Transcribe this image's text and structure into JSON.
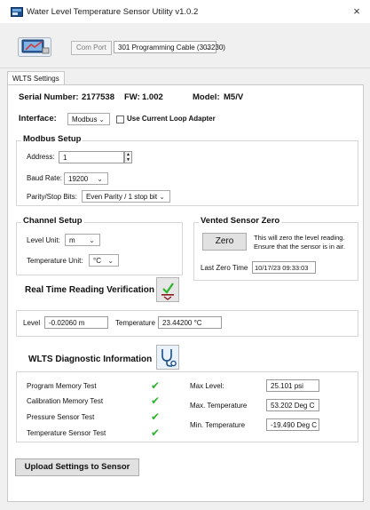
{
  "window": {
    "title": "Water Level Temperature Sensor Utility v1.0.2",
    "close_glyph": "×"
  },
  "toolbar": {
    "com_port_label": "Com Port",
    "com_port_value": "301 Programming Cable (303230)"
  },
  "tabs": [
    {
      "label": "WLTS Settings",
      "active": true
    }
  ],
  "device": {
    "serial_label": "Serial Number:",
    "serial": "2177538",
    "fw_label": "FW:",
    "fw": "1.002",
    "model_label": "Model:",
    "model": "M5/V"
  },
  "interface": {
    "label": "Interface:",
    "value": "Modbus",
    "use_loop_label": "Use Current Loop Adapter",
    "use_loop_checked": false
  },
  "modbus": {
    "title": "Modbus Setup",
    "address_label": "Address:",
    "address": "1",
    "baud_label": "Baud Rate:",
    "baud": "19200",
    "parity_label": "Parity/Stop Bits:",
    "parity": "Even Parity / 1 stop bit"
  },
  "channel": {
    "title": "Channel Setup",
    "level_label": "Level Unit:",
    "level_unit": "m",
    "temp_label": "Temperature Unit:",
    "temp_unit": "°C"
  },
  "vented": {
    "title": "Vented Sensor Zero",
    "zero_button": "Zero",
    "description_line1": "This will zero the level reading.",
    "description_line2": "Ensure that the sensor is in air.",
    "last_zero_label": "Last Zero Time",
    "last_zero_value": "10/17/23 09:33:03"
  },
  "realtime": {
    "title": "Real Time Reading Verification",
    "level_label": "Level",
    "level_value": "-0.02060 m",
    "temp_label": "Temperature",
    "temp_value": "23.44200 °C"
  },
  "diagnostic": {
    "title": "WLTS Diagnostic Information",
    "tests": [
      {
        "label": "Program Memory Test",
        "status": "✔"
      },
      {
        "label": "Calibration Memory Test",
        "status": "✔"
      },
      {
        "label": "Pressure Sensor Test",
        "status": "✔"
      },
      {
        "label": "Temperature Sensor Test",
        "status": "✔"
      }
    ],
    "max_level_label": "Max Level:",
    "max_level": "25.101 psi",
    "max_temp_label": "Max. Temperature",
    "max_temp": "53.202 Deg C",
    "min_temp_label": "Min. Temperature",
    "min_temp": "-19.490 Deg C"
  },
  "upload_button": "Upload Settings to Sensor",
  "colors": {
    "check": "#2bb52b",
    "panel_border": "#c8c8c8",
    "button_face": "#e1e1e1"
  },
  "icons": [
    "app-icon",
    "connect-icon",
    "chevron-down-icon",
    "spin-arrows-icon",
    "reading-check-icon",
    "stethoscope-icon",
    "close-icon",
    "checkmark-icon"
  ]
}
